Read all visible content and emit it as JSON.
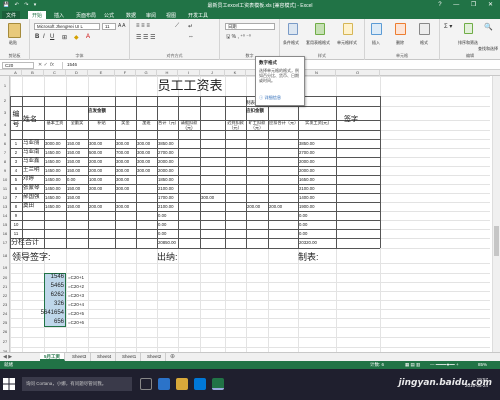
{
  "window": {
    "title": "最新员工excel工资表模板.xls [兼容模式] - Excel",
    "user": "",
    "controls": [
      "?",
      "—",
      "❐",
      "✕"
    ]
  },
  "ribbon": {
    "tabs": [
      "文件",
      "开始",
      "插入",
      "页面布局",
      "公式",
      "数据",
      "审阅",
      "视图",
      "开发工具"
    ],
    "active_tab": "开始",
    "font_name": "Microsoft JhengHei UI L",
    "font_size": "11",
    "number_format": "日期",
    "groups": [
      "剪贴板",
      "字体",
      "对齐方式",
      "数字",
      "样式",
      "单元格",
      "编辑"
    ],
    "buttons": {
      "paste": "粘贴",
      "cond_format": "条件格式",
      "table_format": "套用表格格式",
      "cell_style": "单元格样式",
      "insert": "插入",
      "delete": "删除",
      "format": "格式",
      "sort": "排序和筛选",
      "find": "查找和选择"
    }
  },
  "formula_bar": {
    "name_box": "C20",
    "fx": "fx",
    "value": "1546"
  },
  "columns": [
    "A",
    "B",
    "C",
    "D",
    "E",
    "F",
    "G",
    "H",
    "I",
    "J",
    "K",
    "L",
    "M",
    "N",
    "O"
  ],
  "rows": [
    "1",
    "2",
    "3",
    "4",
    "5",
    "6",
    "7",
    "8",
    "9",
    "10",
    "11",
    "12",
    "13",
    "14",
    "15",
    "16",
    "17",
    "18",
    "19",
    "20",
    "21",
    "22",
    "23",
    "24",
    "25",
    "26",
    "27",
    "28",
    "29"
  ],
  "sheet": {
    "title": "员工工资表",
    "meta": "制表日期：  2015年1月",
    "header_numbered": "编号",
    "header_name": "姓名",
    "header_group_pay": "应发金额",
    "header_group_deduct": "应扣金额",
    "header_basic": "基本工资",
    "header_allowance": "全勤奖",
    "header_subsidy": "补贴",
    "header_bonus": "奖金",
    "header_overtime": "加班",
    "header_total": "合计（元）",
    "header_leave": "请假扣款(元)",
    "header_late": "迟到扣款（元）",
    "header_absent": "旷工扣款（元）",
    "header_deduct_total": "应扣合计（元）",
    "header_actual": "实发工资(元)",
    "header_sign": "签字",
    "employees": [
      {
        "no": "1",
        "name": "马亚丽",
        "basic": "3000.00",
        "allow": "150.00",
        "subsidy": "300.00",
        "bonus": "300.00",
        "ot": "300.00",
        "total": "3850.00",
        "leave": "",
        "late": "",
        "absent": "",
        "dsum": "",
        "actual": "3850.00"
      },
      {
        "no": "2",
        "name": "马亚南",
        "basic": "1450.00",
        "allow": "150.00",
        "subsidy": "500.00",
        "bonus": "700.00",
        "ot": "300.00",
        "total": "2700.00",
        "leave": "",
        "late": "",
        "absent": "",
        "dsum": "",
        "actual": "2700.00"
      },
      {
        "no": "3",
        "name": "马亚鑫",
        "basic": "1450.00",
        "allow": "150.00",
        "subsidy": "200.00",
        "bonus": "300.00",
        "ot": "300.00",
        "total": "2000.00",
        "leave": "",
        "late": "",
        "absent": "",
        "dsum": "",
        "actual": "2000.00"
      },
      {
        "no": "4",
        "name": "王兰明",
        "basic": "1450.00",
        "allow": "150.00",
        "subsidy": "200.00",
        "bonus": "300.00",
        "ot": "300.00",
        "total": "2000.00",
        "leave": "",
        "late": "",
        "absent": "",
        "dsum": "",
        "actual": "2000.00"
      },
      {
        "no": "5",
        "name": "邓婷",
        "basic": "1450.00",
        "allow": "0.00",
        "subsidy": "100.00",
        "bonus": "300.00",
        "ot": "",
        "total": "1850.00",
        "leave": "",
        "late": "",
        "absent": "",
        "dsum": "",
        "actual": "1650.00"
      },
      {
        "no": "6",
        "name": "张蒙琴",
        "basic": "1450.00",
        "allow": "150.00",
        "subsidy": "200.00",
        "bonus": "300.00",
        "ot": "",
        "total": "2100.00",
        "leave": "",
        "late": "",
        "absent": "",
        "dsum": "",
        "actual": "2100.00"
      },
      {
        "no": "7",
        "name": "郝国强",
        "basic": "1450.00",
        "allow": "150.00",
        "subsidy": "",
        "bonus": "",
        "ot": "",
        "total": "1700.00",
        "leave": "300.00",
        "late": "",
        "absent": "",
        "dsum": "",
        "actual": "1400.00"
      },
      {
        "no": "8",
        "name": "奠田",
        "basic": "1450.00",
        "allow": "150.00",
        "subsidy": "200.00",
        "bonus": "300.00",
        "ot": "",
        "total": "2100.00",
        "leave": "",
        "late": "200.00",
        "absent": "",
        "dsum": "200.00",
        "actual": "1900.00"
      },
      {
        "no": "9",
        "name": "",
        "basic": "",
        "allow": "",
        "subsidy": "",
        "bonus": "",
        "ot": "",
        "total": "0.00",
        "leave": "",
        "late": "",
        "absent": "",
        "dsum": "",
        "actual": "0.00"
      },
      {
        "no": "10",
        "name": "",
        "basic": "",
        "allow": "",
        "subsidy": "",
        "bonus": "",
        "ot": "",
        "total": "0.00",
        "leave": "",
        "late": "",
        "absent": "",
        "dsum": "",
        "actual": "0.00"
      },
      {
        "no": "11",
        "name": "",
        "basic": "",
        "allow": "",
        "subsidy": "",
        "bonus": "",
        "ot": "",
        "total": "0.00",
        "leave": "",
        "late": "",
        "absent": "",
        "dsum": "",
        "actual": "0.00"
      }
    ],
    "subtotal_label": "分栏合计",
    "subtotal_total": "20850.00",
    "subtotal_actual": "20320.00",
    "leader_sign": "领导签字:",
    "cashier": "出纳:",
    "preparer": "制表:",
    "calc_values": [
      "1546",
      "5465",
      "6262",
      "326",
      "5641654",
      "656"
    ],
    "calc_formulas": [
      "=C20+1",
      "=C20+2",
      "=C20+3",
      "=C20+4",
      "=C20+5",
      "=C20+6"
    ]
  },
  "tooltip": {
    "title": "数字格式",
    "body": "选择单元格的格式，例如百分比、货币、日期或时间。",
    "link": "详细信息"
  },
  "sheet_tabs": [
    "5月工资",
    "Sheet3",
    "Sheet4",
    "Sheet1",
    "Sheet2"
  ],
  "active_sheet": "5月工资",
  "status": {
    "ready": "就绪",
    "count": "计数: 6",
    "zoom": "85%"
  },
  "taskbar": {
    "cortana": "询问 Cortana，小娜，有问题尽管问我。",
    "time": "19:57",
    "date": "2016-05-24",
    "watermark": "jingyan.baidu.com"
  },
  "colors": {
    "excel_green": "#217346",
    "selection": "#bfd7ea",
    "taskbar": "#1f1f2e"
  }
}
